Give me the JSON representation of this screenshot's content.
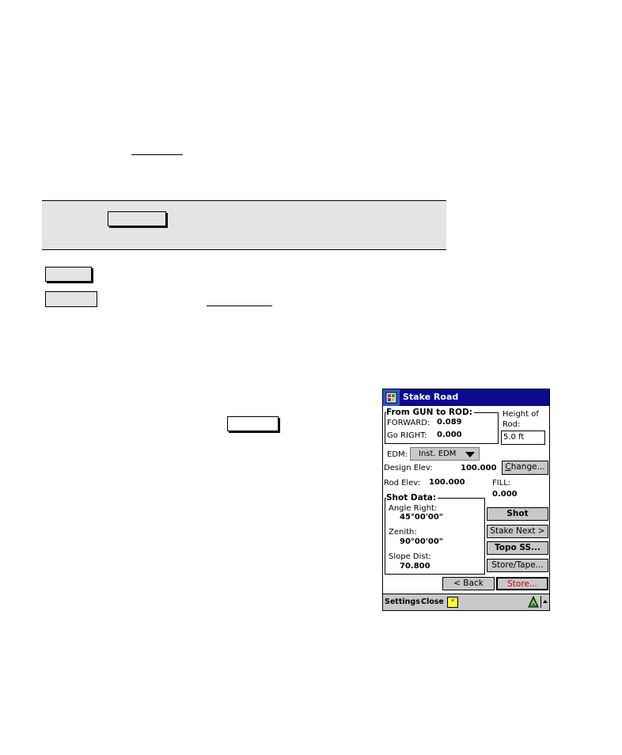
{
  "device": {
    "window_title": "Stake Road",
    "start_icon": "windows-flag-icon",
    "from_gun_group": {
      "label": "From GUN to ROD:",
      "forward_label": "FORWARD:",
      "forward_value": "0.089",
      "right_label": "Go RIGHT:",
      "right_value": "0.000"
    },
    "height_of_rod": {
      "label_line1": "Height of",
      "label_line2": "Rod:",
      "value": "5.0 ft"
    },
    "edm": {
      "label": "EDM:",
      "selected": "Inst. EDM"
    },
    "design_elev": {
      "label": "Design Elev:",
      "value": "100.000"
    },
    "change_button": {
      "label": "Change...",
      "mnemonic": "C"
    },
    "rod_elev": {
      "label": "Rod Elev:",
      "value": "100.000"
    },
    "fill": {
      "label": "FILL:",
      "value": "0.000"
    },
    "shot_data": {
      "label": "Shot Data:",
      "angle_right_label": "Angle Right:",
      "angle_right_value": "45°00'00\"",
      "zenith_label": "Zenith:",
      "zenith_value": "90°00'00\"",
      "slope_dist_label": "Slope Dist:",
      "slope_dist_value": "70.800"
    },
    "buttons": {
      "shot": "Shot",
      "stake_next": "Stake Next >",
      "topo_ss": "Topo SS...",
      "store_tape": "Store/Tape...",
      "back": "< Back",
      "store": "Store..."
    },
    "taskbar": {
      "settings": "Settings",
      "close": "Close",
      "sip_icon": "keyboard-sip-icon",
      "network_icon": "triangle-status-icon",
      "up_icon": "up-arrow-icon"
    },
    "colors": {
      "title_bar": "#0b0b8c",
      "store_text": "#d00000",
      "button_face": "#c8c8c8"
    }
  }
}
